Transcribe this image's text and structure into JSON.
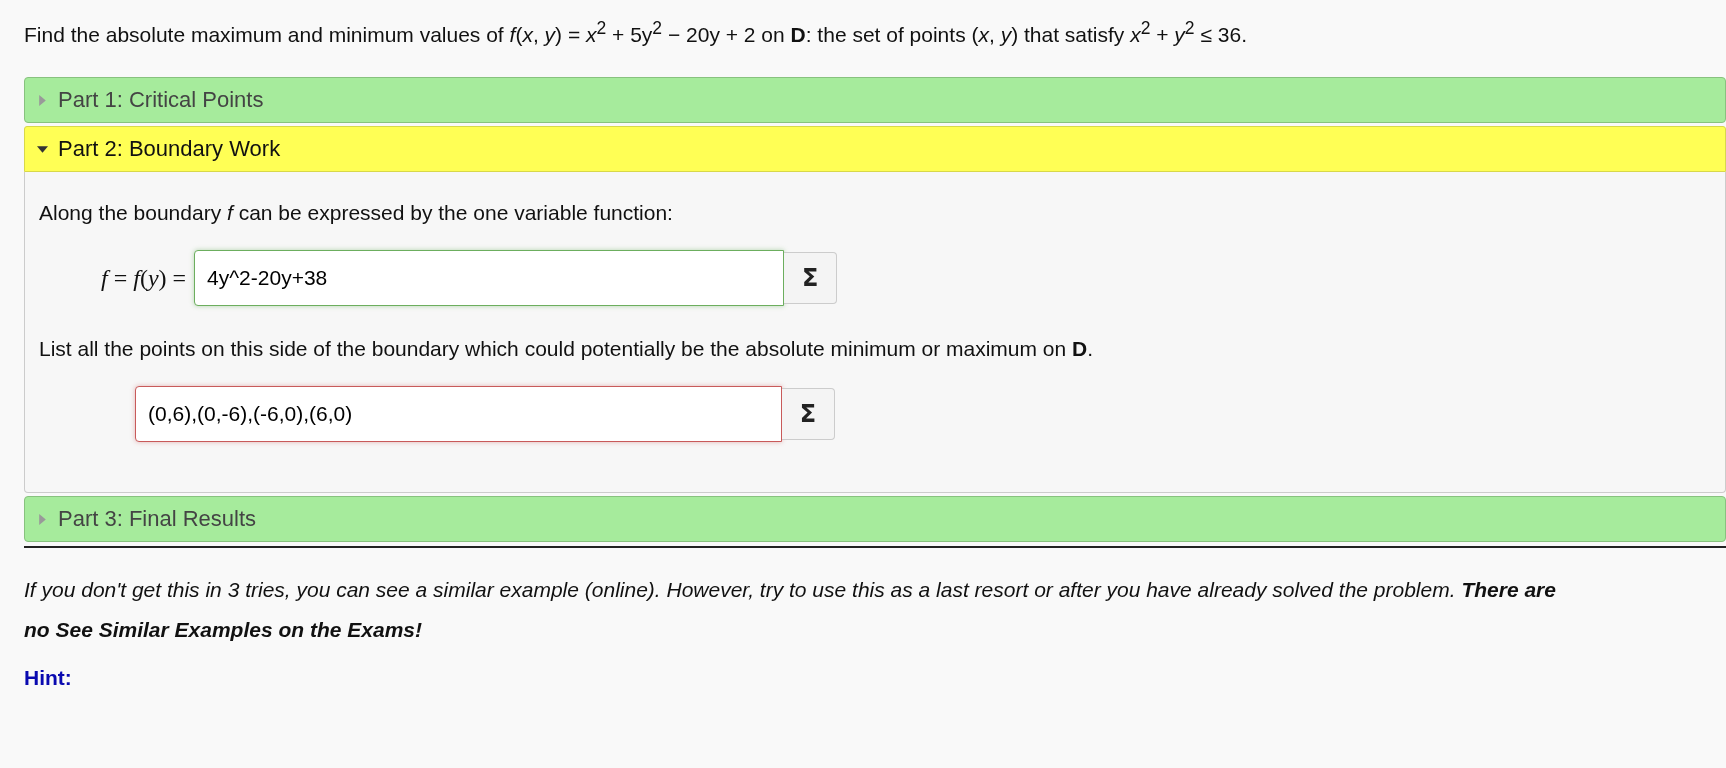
{
  "question": "Find the absolute maximum and minimum values of *f*(*x*, *y*) = *x*$^{2}$ + 5y$^{2}$ − 20y + 2 on **D**: the set of points (*x*, *y*) that satisfy *x*$^{2}$ + *y*$^{2}$ ≤ 36.",
  "parts": [
    {
      "label": "Part 1: Critical Points",
      "expanded": false
    },
    {
      "label": "Part 2: Boundary Work",
      "expanded": true,
      "content": {
        "prompt": "Along the boundary *f* can be expressed by the one variable function:",
        "formula_label": "*f* = *f*(*y*) =",
        "answer_1": {
          "value": "4y^2-20y+38",
          "correct": true,
          "button": "Σ"
        },
        "list_prompt": "List all the points on this side of the boundary which could potentially be the absolute minimum or maximum on **D**.",
        "answer_2": {
          "value": "(0,6),(0,-6),(-6,0),(6,0)",
          "correct": false,
          "button": "Σ"
        }
      }
    },
    {
      "label": "Part 3: Final Results",
      "expanded": false
    }
  ],
  "note": "If you don't get this in 3 tries, you can see a similar example (online). However, try to use this as a last resort or after you have already solved the problem. **There are no See Similar Examples on the Exams!**",
  "hint": "Hint:"
}
